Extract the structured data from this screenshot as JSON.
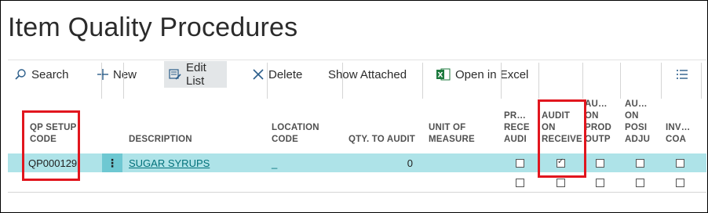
{
  "page": {
    "title": "Item Quality Procedures"
  },
  "toolbar": {
    "search": "Search",
    "new": "New",
    "edit_list": "Edit List",
    "delete": "Delete",
    "show_attached": "Show Attached",
    "open_in_excel": "Open in Excel"
  },
  "columns": {
    "qp_setup_code": "QP SETUP\nCODE",
    "description": "DESCRIPTION",
    "location_code": "LOCATION\nCODE",
    "qty_to_audit": "QTY. TO AUDIT",
    "unit_of_measure": "UNIT OF\nMEASURE",
    "pr_rece_audi": "PR…\nRECE\nAUDI",
    "audit_on_receive": "AUDIT\nON\nRECEIVE",
    "au_on_prod_outp": "AU…\nON\nPROD\nOUTP",
    "au_on_posi_adju": "AU…\nON\nPOSI\nADJU",
    "inv_coa": "INV…\nCOA"
  },
  "rows": [
    {
      "qp_setup_code": "QP000129",
      "description": "SUGAR SYRUPS",
      "location_code": "_",
      "qty_to_audit": "0",
      "unit_of_measure": "",
      "pr_rece_audi": false,
      "audit_on_receive": true,
      "au_on_prod_outp": false,
      "au_on_posi_adju": false,
      "inv_coa": false
    },
    {
      "qp_setup_code": "",
      "description": "",
      "location_code": "",
      "qty_to_audit": "",
      "unit_of_measure": "",
      "pr_rece_audi": false,
      "audit_on_receive": false,
      "au_on_prod_outp": false,
      "au_on_posi_adju": false,
      "inv_coa": false
    }
  ],
  "colors": {
    "selected_row": "#aee3e8",
    "link": "#00707a",
    "highlight_box": "#e1161e",
    "excel_green": "#1d7a3e"
  }
}
